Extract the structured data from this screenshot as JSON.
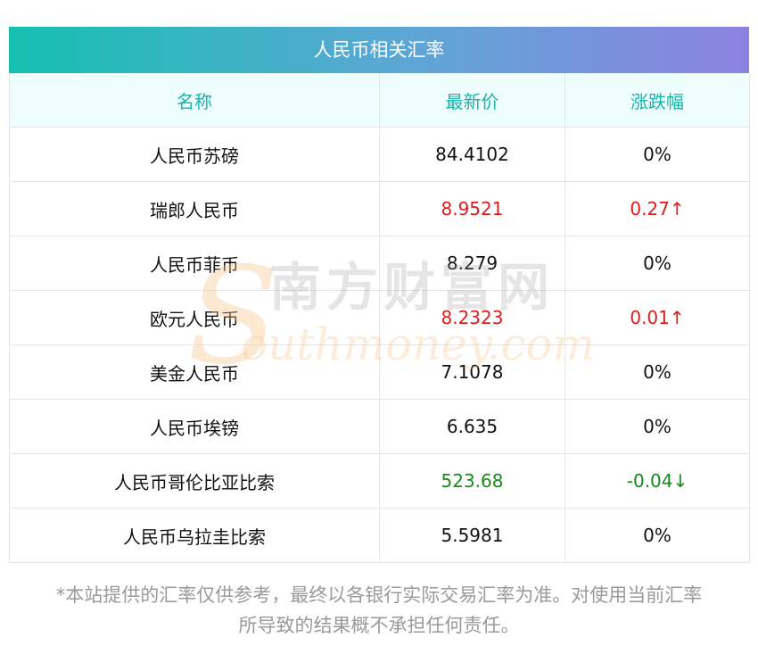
{
  "title": "人民币相关汇率",
  "headers": {
    "name": "名称",
    "price": "最新价",
    "change": "涨跌幅"
  },
  "rows": [
    {
      "name": "人民币苏磅",
      "price": "84.4102",
      "change": "0%",
      "trend": "flat"
    },
    {
      "name": "瑞郎人民币",
      "price": "8.9521",
      "change": "0.27↑",
      "trend": "up"
    },
    {
      "name": "人民币菲币",
      "price": "8.279",
      "change": "0%",
      "trend": "flat"
    },
    {
      "name": "欧元人民币",
      "price": "8.2323",
      "change": "0.01↑",
      "trend": "up"
    },
    {
      "name": "美金人民币",
      "price": "7.1078",
      "change": "0%",
      "trend": "flat"
    },
    {
      "name": "人民币埃镑",
      "price": "6.635",
      "change": "0%",
      "trend": "flat"
    },
    {
      "name": "人民币哥伦比亚比索",
      "price": "523.68",
      "change": "-0.04↓",
      "trend": "down"
    },
    {
      "name": "人民币乌拉圭比索",
      "price": "5.5981",
      "change": "0%",
      "trend": "flat"
    }
  ],
  "watermark": {
    "chinese": "南方财富网",
    "english": "Southmoney.com"
  },
  "disclaimer": {
    "line1": "*本站提供的汇率仅供参考，最终以各银行实际交易汇率为准。对使用当前汇率",
    "line2": "所导致的结果概不承担任何责任。"
  },
  "colors": {
    "up": "#e01b1b",
    "down": "#168a1a",
    "header_text": "#19b3a8",
    "header_bg": "#eefefe"
  }
}
